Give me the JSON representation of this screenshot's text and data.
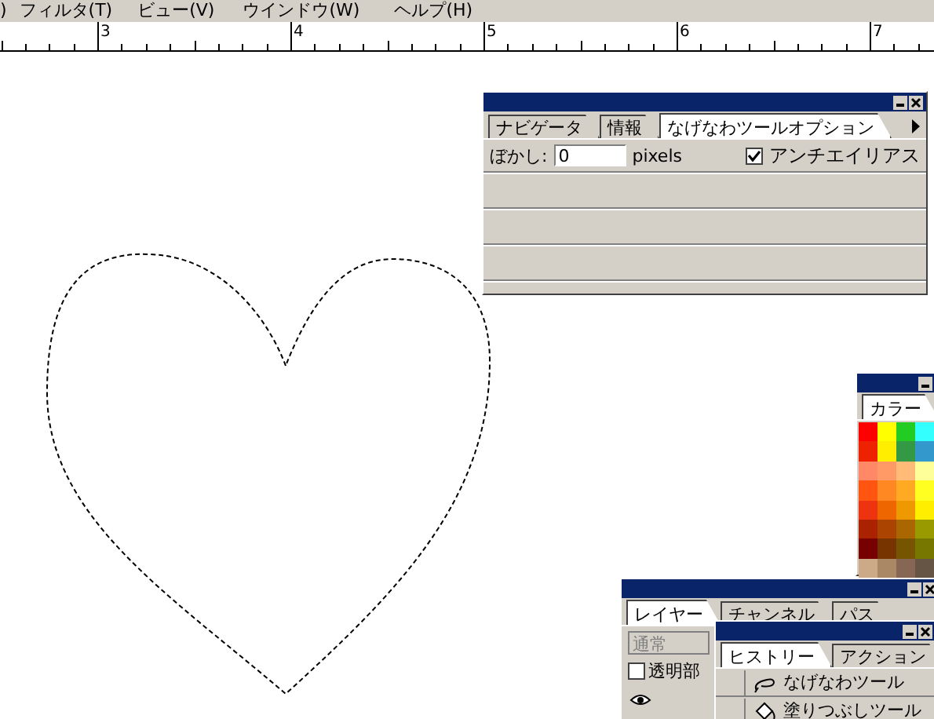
{
  "menu": [
    {
      "label": ")"
    },
    {
      "label": "フィルタ(T)"
    },
    {
      "label": "ビュー(V)"
    },
    {
      "label": "ウインドウ(W)"
    },
    {
      "label": "ヘルプ(H)"
    }
  ],
  "ruler": {
    "labels": [
      "3",
      "4",
      "5",
      "6",
      "7"
    ]
  },
  "options_palette": {
    "tabs": [
      {
        "label": "ナビゲータ",
        "selected": false
      },
      {
        "label": "情報",
        "selected": false
      },
      {
        "label": "なげなわツールオプション",
        "selected": true
      }
    ],
    "feather_label": "ぼかし:",
    "feather_value": "0",
    "feather_unit": "pixels",
    "antialias": {
      "label": "アンチエイリアス",
      "checked": true
    }
  },
  "color_palette": {
    "tabs": [
      {
        "label": "カラー",
        "selected": true
      }
    ],
    "swatches": [
      {
        "color": "#ff0000"
      },
      {
        "color": "#ffff00"
      },
      {
        "color": "#22cc22"
      },
      {
        "color": "#33ffff"
      },
      {
        "color": "#ee2200"
      },
      {
        "color": "#ffee00"
      },
      {
        "color": "#339944"
      },
      {
        "color": "#3399cc"
      },
      {
        "color": "#ff8866"
      },
      {
        "color": "#ff9966"
      },
      {
        "color": "#ffbb77"
      },
      {
        "color": "#ffff99"
      },
      {
        "color": "#ff5511"
      },
      {
        "color": "#ff8822"
      },
      {
        "color": "#ffaa22"
      },
      {
        "color": "#ffff22"
      },
      {
        "color": "#ee3311"
      },
      {
        "color": "#ee6600"
      },
      {
        "color": "#ee9900"
      },
      {
        "color": "#ffee00"
      },
      {
        "color": "#aa2200"
      },
      {
        "color": "#aa4400"
      },
      {
        "color": "#aa6600"
      },
      {
        "color": "#999900"
      },
      {
        "color": "#770000"
      },
      {
        "color": "#773300"
      },
      {
        "color": "#775500"
      },
      {
        "color": "#777700"
      },
      {
        "color": "#ccaa88"
      },
      {
        "color": "#aa8866"
      },
      {
        "color": "#886655"
      },
      {
        "color": "#665544"
      }
    ]
  },
  "layers_palette": {
    "tabs": [
      {
        "label": "レイヤー",
        "selected": true
      },
      {
        "label": "チャンネル",
        "selected": false
      },
      {
        "label": "パス",
        "selected": false
      }
    ],
    "blend_mode": "通常",
    "preserve_transparency": {
      "label": "透明部",
      "checked": false
    }
  },
  "history_palette": {
    "tabs": [
      {
        "label": "ヒストリー",
        "selected": true
      },
      {
        "label": "アクション",
        "selected": false
      }
    ],
    "rows": [
      {
        "label": "なげなわツール",
        "kind": "lasso"
      },
      {
        "label": "塗りつぶしツール",
        "kind": "bucket"
      }
    ]
  }
}
